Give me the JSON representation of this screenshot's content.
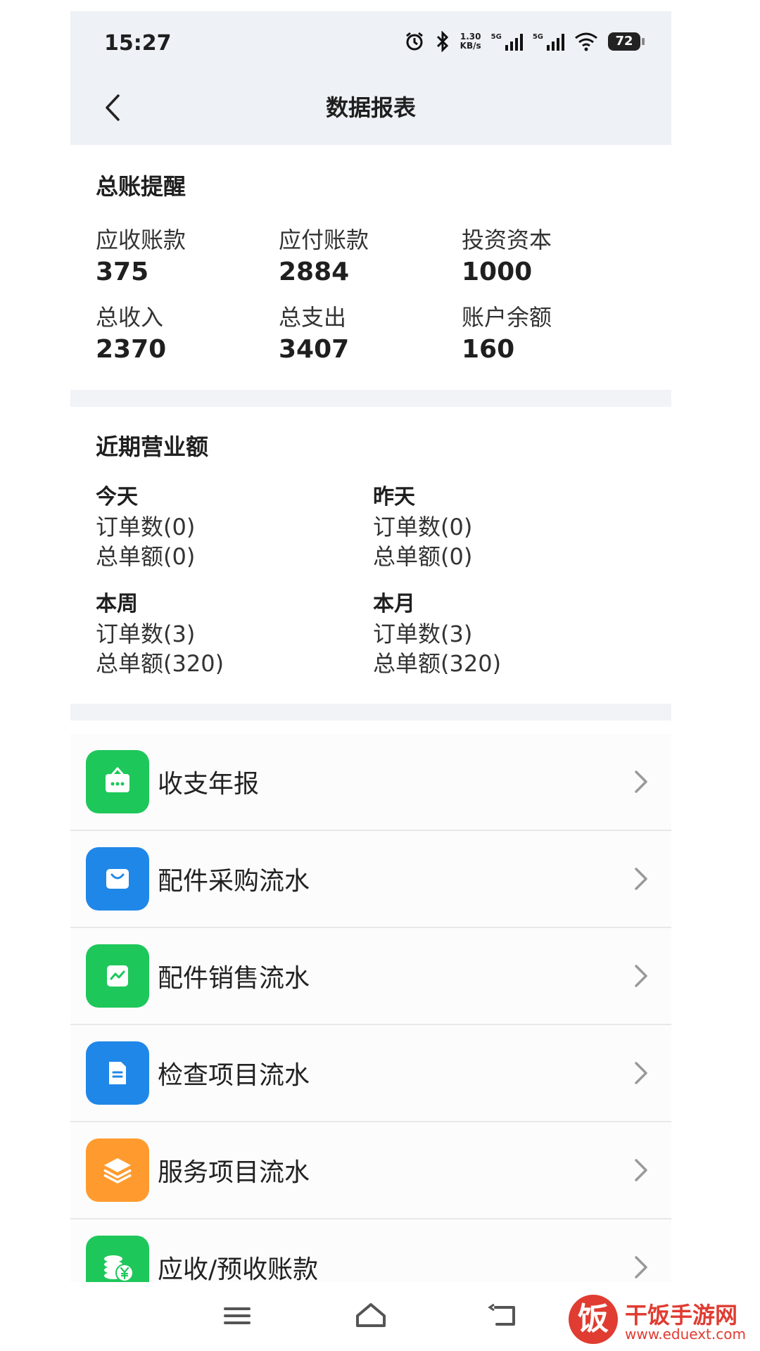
{
  "status_bar": {
    "time": "15:27",
    "net_speed_value": "1.30",
    "net_speed_unit": "KB/s",
    "sig1": "5G",
    "sig2": "5G",
    "battery": "72"
  },
  "nav": {
    "title": "数据报表"
  },
  "ledger": {
    "title": "总账提醒",
    "items": [
      {
        "label": "应收账款",
        "value": "375"
      },
      {
        "label": "应付账款",
        "value": "2884"
      },
      {
        "label": "投资资本",
        "value": "1000"
      },
      {
        "label": "总收入",
        "value": "2370"
      },
      {
        "label": "总支出",
        "value": "3407"
      },
      {
        "label": "账户余额",
        "value": "160"
      }
    ]
  },
  "revenue": {
    "title": "近期营业额",
    "periods": [
      {
        "name": "今天",
        "orders": "订单数(0)",
        "amount": "总单额(0)"
      },
      {
        "name": "昨天",
        "orders": "订单数(0)",
        "amount": "总单额(0)"
      },
      {
        "name": "本周",
        "orders": "订单数(3)",
        "amount": "总单额(320)"
      },
      {
        "name": "本月",
        "orders": "订单数(3)",
        "amount": "总单额(320)"
      }
    ]
  },
  "menu": {
    "items": [
      {
        "label": "收支年报",
        "icon": "calendar-board-icon",
        "color": "#1ec75a"
      },
      {
        "label": "配件采购流水",
        "icon": "shopping-bag-icon",
        "color": "#1f87e8"
      },
      {
        "label": "配件销售流水",
        "icon": "trend-chart-icon",
        "color": "#1ec75a"
      },
      {
        "label": "检查项目流水",
        "icon": "document-icon",
        "color": "#1f87e8"
      },
      {
        "label": "服务项目流水",
        "icon": "layers-icon",
        "color": "#ff9b2e"
      },
      {
        "label": "应收/预收账款",
        "icon": "coins-icon",
        "color": "#1ec75a"
      }
    ]
  },
  "watermark": {
    "logo": "饭",
    "name": "干饭手游网",
    "url": "www.eduext.com"
  }
}
